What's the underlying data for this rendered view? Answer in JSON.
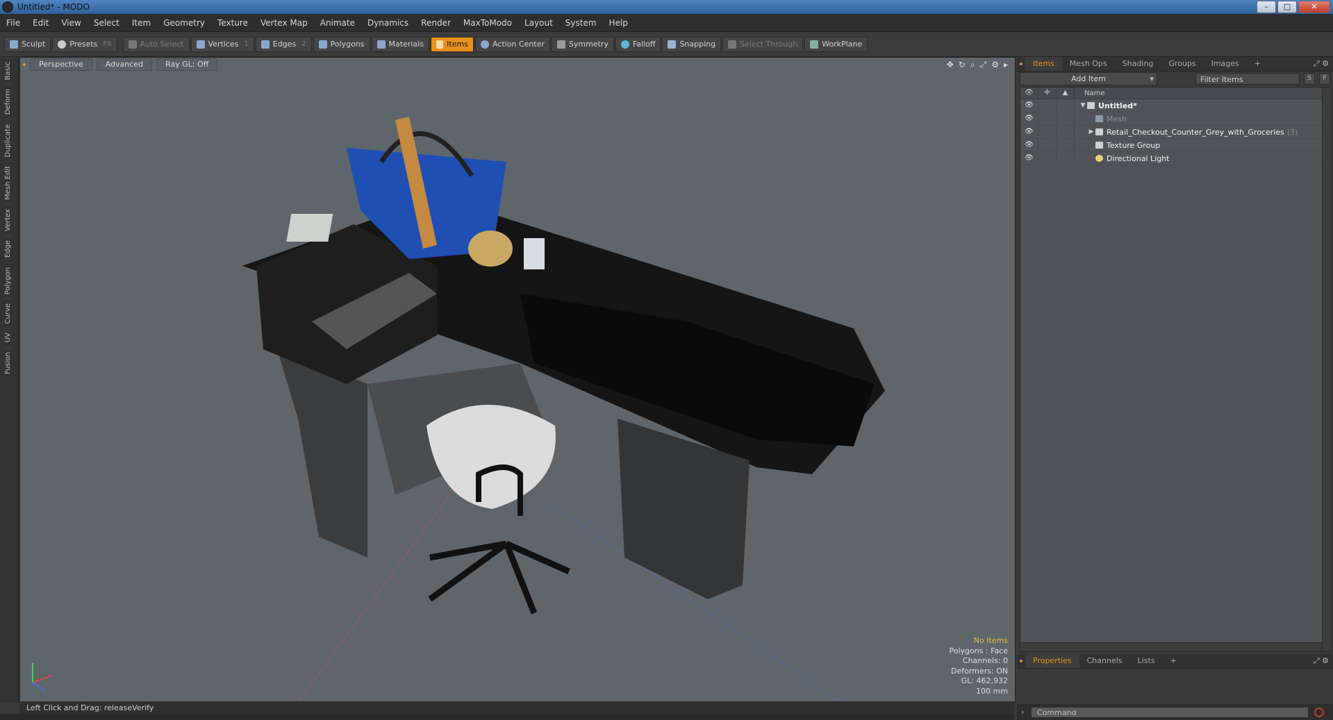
{
  "window": {
    "title": "Untitled* - MODO",
    "min": "–",
    "max": "□",
    "close": "✕"
  },
  "menu": [
    "File",
    "Edit",
    "View",
    "Select",
    "Item",
    "Geometry",
    "Texture",
    "Vertex Map",
    "Animate",
    "Dynamics",
    "Render",
    "MaxToModo",
    "Layout",
    "System",
    "Help"
  ],
  "toolbar": {
    "sculpt": "Sculpt",
    "presets": "Presets",
    "presets_key": "F6",
    "auto_select": "Auto Select",
    "vertices": "Vertices",
    "vertices_key": "1",
    "edges": "Edges",
    "edges_key": "2",
    "polygons": "Polygons",
    "materials": "Materials",
    "items": "Items",
    "action_center": "Action Center",
    "symmetry": "Symmetry",
    "falloff": "Falloff",
    "snapping": "Snapping",
    "select_through": "Select Through",
    "workplane": "WorkPlane"
  },
  "left_tabs": [
    "Basic",
    "Deform",
    "Duplicate",
    "Mesh Edit",
    "Vertex",
    "Edge",
    "Polygon",
    "Curve",
    "UV",
    "Fusion"
  ],
  "viewport": {
    "perspective": "Perspective",
    "advanced": "Advanced",
    "raygl": "Ray GL: Off",
    "hud": {
      "no_items": "No Items",
      "polygons": "Polygons : Face",
      "channels": "Channels: 0",
      "deformers": "Deformers: ON",
      "gl": "GL: 462,932",
      "scale": "100 mm"
    }
  },
  "status": "Left Click and Drag:   releaseVerify",
  "right_panel": {
    "tabs": [
      "Items",
      "Mesh Ops",
      "Shading",
      "Groups",
      "Images"
    ],
    "add_tab": "+",
    "add_item": "Add Item",
    "filter": "Filter Items",
    "s_btn": "S",
    "f_btn": "F",
    "name_col": "Name",
    "items": [
      {
        "name": "Untitled*",
        "count": ""
      },
      {
        "name": "Mesh",
        "count": ""
      },
      {
        "name": "Retail_Checkout_Counter_Grey_with_Groceries",
        "count": "(3)"
      },
      {
        "name": "Texture Group",
        "count": ""
      },
      {
        "name": "Directional Light",
        "count": ""
      }
    ],
    "prop_tabs": [
      "Properties",
      "Channels",
      "Lists"
    ],
    "command_placeholder": "Command"
  },
  "colors": {
    "accent": "#e8901c",
    "viewport_bg": "#5e666c"
  }
}
